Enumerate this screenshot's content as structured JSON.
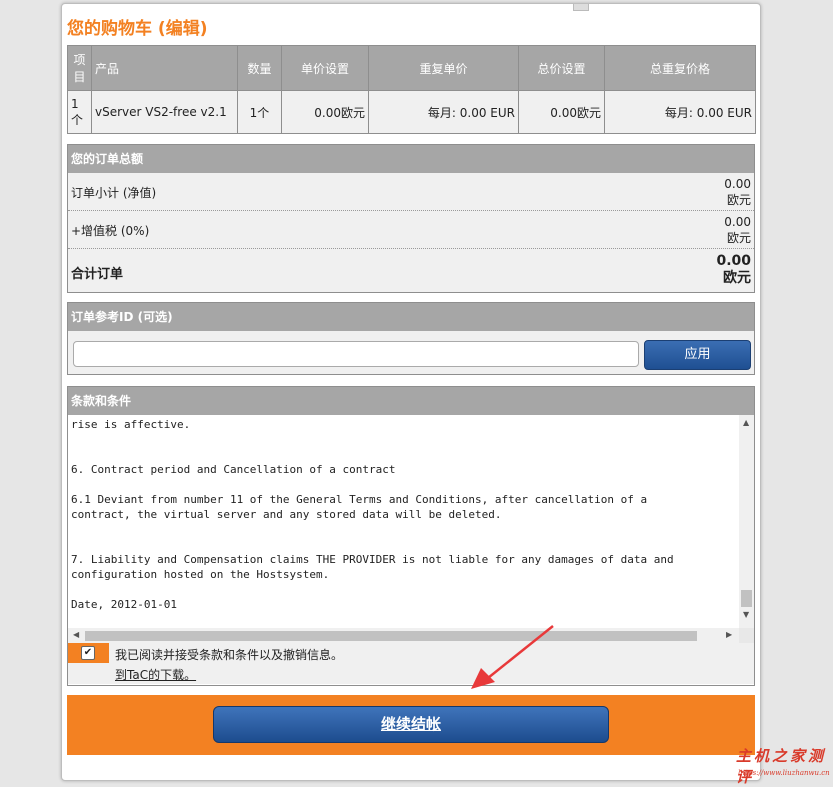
{
  "cart": {
    "title": "您的购物车 (编辑)",
    "columns": [
      "项目",
      "产品",
      "数量",
      "单价设置",
      "重复单价",
      "总价设置",
      "总重复价格"
    ],
    "rows": [
      [
        "1个",
        "vServer VS2-free v2.1",
        "1个",
        "0.00欧元",
        "每月: 0.00 EUR",
        "0.00欧元",
        "每月: 0.00 EUR"
      ]
    ]
  },
  "summary": {
    "title": "您的订单总额",
    "subtotal_label": "订单小计 (净值)",
    "subtotal_value": "0.00\n欧元",
    "vat_label": "+增值税 (0%)",
    "vat_value": "0.00\n欧元",
    "total_label": "合计订单",
    "total_value": "0.00\n欧元"
  },
  "reference": {
    "title": "订单参考ID (可选)",
    "input_value": "",
    "apply_label": "应用"
  },
  "terms": {
    "title": "条款和条件",
    "lines": [
      "rise is affective.",
      "",
      "",
      "6. Contract period and Cancellation of a contract",
      "",
      "6.1 Deviant from number 11 of the General Terms and Conditions, after cancellation of a",
      "contract, the virtual server and any stored data will be deleted.",
      "",
      "",
      "7. Liability and Compensation claims THE PROVIDER is not liable for any damages of data and",
      "configuration hosted on the Hostsystem.",
      "",
      "Date, 2012-01-01"
    ],
    "accept_label": "我已阅读并接受条款和条件以及撤销信息。",
    "accept_checked": true,
    "download_link": "到TaC的下载。"
  },
  "checkout": {
    "button_label": "继续结帐"
  },
  "watermark": {
    "main": "主机之家测评",
    "url": "https://www.liuzhanwu.cn"
  },
  "colors": {
    "accent": "#f38122",
    "header_gray": "#a6a6a6",
    "button_blue": "#2a5ba1",
    "annotation_red": "#e8393a"
  }
}
